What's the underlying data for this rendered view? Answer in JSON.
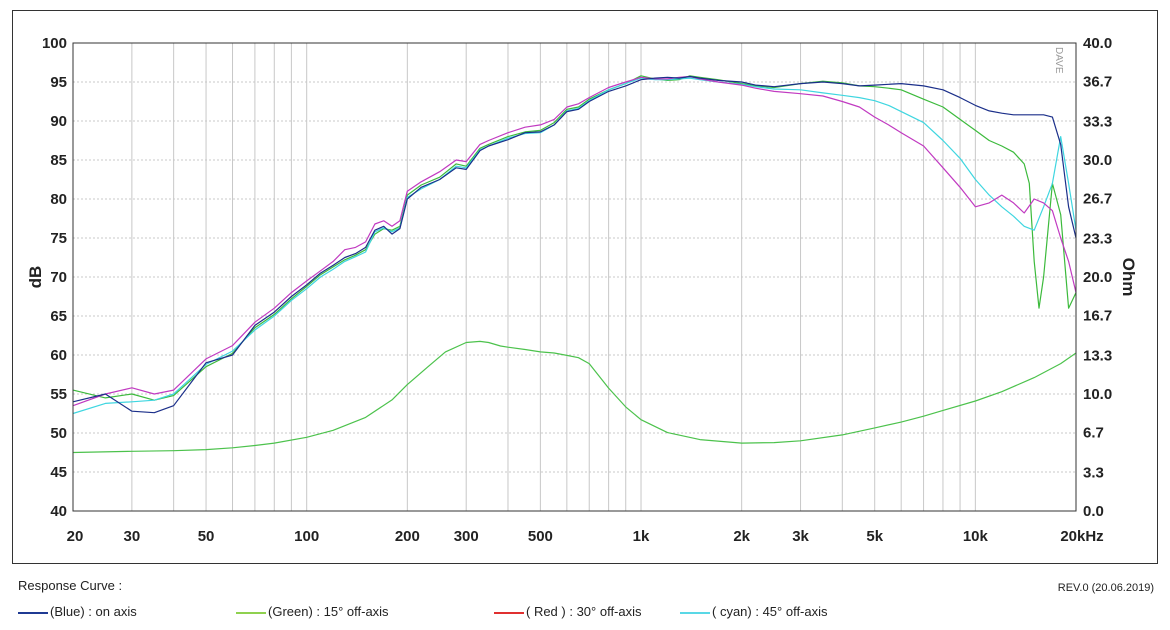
{
  "watermark": "DAVE",
  "footer": {
    "title": "Response Curve :",
    "revision": "REV.0 (20.06.2019)"
  },
  "chart_data": {
    "type": "line",
    "xlabel": "",
    "ylabel": "dB",
    "y2label": "Ohm",
    "xscale": "log",
    "xlim": [
      20,
      20000
    ],
    "ylim": [
      40,
      100
    ],
    "y2lim": [
      0,
      40
    ],
    "grid": true,
    "legend_position": "bottom",
    "x_ticks": [
      {
        "value": 20,
        "label": "20"
      },
      {
        "value": 30,
        "label": "30"
      },
      {
        "value": 50,
        "label": "50"
      },
      {
        "value": 100,
        "label": "100"
      },
      {
        "value": 200,
        "label": "200"
      },
      {
        "value": 300,
        "label": "300"
      },
      {
        "value": 500,
        "label": "500"
      },
      {
        "value": 1000,
        "label": "1k"
      },
      {
        "value": 2000,
        "label": "2k"
      },
      {
        "value": 3000,
        "label": "3k"
      },
      {
        "value": 5000,
        "label": "5k"
      },
      {
        "value": 10000,
        "label": "10k"
      },
      {
        "value": 20000,
        "label": "20kHz"
      }
    ],
    "y_ticks": [
      {
        "value": 40,
        "label": "40"
      },
      {
        "value": 45,
        "label": "45"
      },
      {
        "value": 50,
        "label": "50"
      },
      {
        "value": 55,
        "label": "55"
      },
      {
        "value": 60,
        "label": "60"
      },
      {
        "value": 65,
        "label": "65"
      },
      {
        "value": 70,
        "label": "70"
      },
      {
        "value": 75,
        "label": "75"
      },
      {
        "value": 80,
        "label": "80"
      },
      {
        "value": 85,
        "label": "85"
      },
      {
        "value": 90,
        "label": "90"
      },
      {
        "value": 95,
        "label": "95"
      },
      {
        "value": 100,
        "label": "100"
      }
    ],
    "y2_ticks": [
      {
        "value": 0,
        "label": "0.0"
      },
      {
        "value": 3.3,
        "label": "3.3"
      },
      {
        "value": 6.7,
        "label": "6.7"
      },
      {
        "value": 10,
        "label": "10.0"
      },
      {
        "value": 13.3,
        "label": "13.3"
      },
      {
        "value": 16.7,
        "label": "16.7"
      },
      {
        "value": 20,
        "label": "20.0"
      },
      {
        "value": 23.3,
        "label": "23.3"
      },
      {
        "value": 26.7,
        "label": "26.7"
      },
      {
        "value": 30,
        "label": "30.0"
      },
      {
        "value": 33.3,
        "label": "33.3"
      },
      {
        "value": 36.7,
        "label": "36.7"
      },
      {
        "value": 40,
        "label": "40.0"
      }
    ],
    "series": [
      {
        "name": "on axis",
        "legend": "(Blue)  : on axis",
        "color": "#1b2f8a",
        "swatch_color": "#1f3a93",
        "axis": "left",
        "x": [
          20,
          25,
          30,
          35,
          40,
          50,
          60,
          70,
          80,
          90,
          100,
          110,
          120,
          130,
          140,
          150,
          160,
          170,
          180,
          190,
          200,
          220,
          250,
          280,
          300,
          330,
          350,
          400,
          450,
          500,
          550,
          600,
          650,
          700,
          800,
          900,
          1000,
          1100,
          1200,
          1300,
          1400,
          1500,
          1700,
          2000,
          2200,
          2500,
          3000,
          3500,
          4000,
          4500,
          5000,
          5500,
          6000,
          7000,
          8000,
          9000,
          10000,
          11000,
          12000,
          13000,
          14000,
          15000,
          16000,
          17000,
          18000,
          19000,
          20000
        ],
        "y": [
          54,
          55,
          52.8,
          52.6,
          53.5,
          59,
          60,
          63.8,
          65.5,
          67.5,
          69,
          70.5,
          71.5,
          72.5,
          73,
          73.8,
          76,
          76.5,
          75.5,
          76.2,
          80,
          81.5,
          82.5,
          84,
          83.8,
          86.2,
          86.8,
          87.6,
          88.5,
          88.6,
          89.5,
          91.2,
          91.5,
          92.5,
          93.8,
          94.5,
          95.3,
          95.5,
          95.6,
          95.5,
          95.7,
          95.5,
          95.2,
          95,
          94.6,
          94.4,
          94.8,
          95,
          94.8,
          94.5,
          94.6,
          94.7,
          94.8,
          94.5,
          94,
          93,
          92,
          91.3,
          91,
          90.8,
          90.8,
          90.8,
          90.8,
          90.5,
          87,
          79,
          75
        ]
      },
      {
        "name": "15° off-axis",
        "legend": "(Green) : 15° off-axis",
        "color": "#3cba3c",
        "swatch_color": "#8fd14f",
        "axis": "left",
        "x": [
          20,
          25,
          30,
          35,
          40,
          50,
          60,
          70,
          80,
          90,
          100,
          110,
          120,
          130,
          140,
          150,
          160,
          170,
          180,
          190,
          200,
          220,
          250,
          280,
          300,
          330,
          350,
          400,
          450,
          500,
          550,
          600,
          650,
          700,
          800,
          900,
          1000,
          1100,
          1200,
          1300,
          1400,
          1500,
          1700,
          2000,
          2200,
          2500,
          3000,
          3500,
          4000,
          4500,
          5000,
          5500,
          6000,
          7000,
          8000,
          9000,
          10000,
          11000,
          12000,
          13000,
          14000,
          14500,
          15000,
          15500,
          16000,
          17000,
          18000,
          19000,
          20000
        ],
        "y": [
          55.5,
          54.5,
          55,
          54.2,
          54.8,
          58.5,
          60.2,
          63.5,
          65.2,
          67.2,
          68.8,
          70.3,
          71.3,
          72.2,
          72.8,
          73.5,
          75.5,
          76.2,
          76,
          76.5,
          80.5,
          81.8,
          82.8,
          84.5,
          84.2,
          86.5,
          87,
          88,
          88.6,
          88.8,
          89.8,
          91.5,
          91.8,
          92.8,
          94,
          94.8,
          95.8,
          95.4,
          95.2,
          95.3,
          95.8,
          95.6,
          95.3,
          94.8,
          94.5,
          94.3,
          94.8,
          95.1,
          94.9,
          94.5,
          94.4,
          94.2,
          94,
          92.8,
          91.8,
          90.2,
          88.8,
          87.5,
          86.8,
          86,
          84.5,
          82,
          72,
          66,
          70,
          82,
          78,
          66,
          68
        ]
      },
      {
        "name": "30° off-axis",
        "legend": "( Red ) : 30° off-axis",
        "color": "#c13ac1",
        "swatch_color": "#e03030",
        "axis": "left",
        "x": [
          20,
          25,
          30,
          35,
          40,
          50,
          60,
          70,
          80,
          90,
          100,
          110,
          120,
          130,
          140,
          150,
          160,
          170,
          180,
          190,
          200,
          220,
          250,
          280,
          300,
          330,
          350,
          400,
          450,
          500,
          550,
          600,
          650,
          700,
          800,
          900,
          1000,
          1100,
          1200,
          1300,
          1400,
          1500,
          1700,
          2000,
          2200,
          2500,
          3000,
          3500,
          4000,
          4500,
          5000,
          5500,
          6000,
          7000,
          8000,
          9000,
          10000,
          11000,
          12000,
          13000,
          14000,
          15000,
          16000,
          17000,
          18000,
          19000,
          20000
        ],
        "y": [
          53.5,
          55,
          55.8,
          55,
          55.5,
          59.5,
          61.2,
          64.2,
          66,
          68,
          69.5,
          70.8,
          72,
          73.5,
          73.8,
          74.5,
          76.8,
          77.2,
          76.5,
          77.2,
          81,
          82.2,
          83.5,
          85,
          84.8,
          87,
          87.5,
          88.5,
          89.2,
          89.5,
          90.2,
          91.8,
          92.2,
          93,
          94.3,
          95,
          95.6,
          95.4,
          95.4,
          95.6,
          95.7,
          95.4,
          95,
          94.6,
          94.2,
          93.8,
          93.5,
          93.2,
          92.5,
          91.8,
          90.5,
          89.5,
          88.5,
          86.8,
          84,
          81.5,
          79,
          79.5,
          80.5,
          79.5,
          78.2,
          80,
          79.5,
          78.5,
          75,
          72,
          68
        ]
      },
      {
        "name": "45° off-axis",
        "legend": "( cyan) : 45° off-axis",
        "color": "#3fd6e0",
        "swatch_color": "#59d8e6",
        "axis": "left",
        "x": [
          20,
          25,
          30,
          35,
          40,
          50,
          60,
          70,
          80,
          90,
          100,
          110,
          120,
          130,
          140,
          150,
          160,
          170,
          180,
          190,
          200,
          220,
          250,
          280,
          300,
          330,
          350,
          400,
          450,
          500,
          550,
          600,
          650,
          700,
          800,
          900,
          1000,
          1100,
          1200,
          1300,
          1400,
          1500,
          1700,
          2000,
          2200,
          2500,
          3000,
          3500,
          4000,
          4500,
          5000,
          5500,
          6000,
          7000,
          8000,
          9000,
          10000,
          11000,
          12000,
          13000,
          14000,
          15000,
          16000,
          17000,
          18000,
          19000,
          20000
        ],
        "y": [
          52.5,
          53.8,
          54,
          54.2,
          55,
          58.8,
          60.5,
          63.2,
          65,
          67,
          68.5,
          70,
          71,
          72,
          72.6,
          73.2,
          75.8,
          76.3,
          75.8,
          76.3,
          80.2,
          81.3,
          82.5,
          84.2,
          84,
          86.3,
          86.8,
          87.8,
          88.4,
          88.5,
          89.5,
          91.3,
          91.6,
          92.6,
          94,
          94.8,
          95.5,
          95.3,
          95.3,
          95.4,
          95.5,
          95.3,
          95,
          94.7,
          94.4,
          94.1,
          94,
          93.6,
          93.3,
          93,
          92.6,
          92,
          91.2,
          89.8,
          87.5,
          85.2,
          82.5,
          80.5,
          79,
          77.8,
          76.5,
          76,
          79,
          82,
          88,
          82,
          76
        ]
      },
      {
        "name": "impedance",
        "color": "#4cc24c",
        "axis": "right",
        "x": [
          20,
          30,
          40,
          50,
          60,
          70,
          80,
          100,
          120,
          150,
          180,
          200,
          230,
          260,
          300,
          330,
          350,
          380,
          400,
          450,
          500,
          550,
          600,
          650,
          700,
          800,
          900,
          1000,
          1200,
          1500,
          2000,
          2500,
          3000,
          4000,
          5000,
          6000,
          7000,
          8000,
          10000,
          12000,
          15000,
          18000,
          20000
        ],
        "y": [
          5,
          5.1,
          5.15,
          5.25,
          5.4,
          5.6,
          5.8,
          6.3,
          6.9,
          8,
          9.5,
          10.8,
          12.3,
          13.6,
          14.4,
          14.5,
          14.4,
          14.1,
          14,
          13.8,
          13.6,
          13.5,
          13.3,
          13.1,
          12.6,
          10.5,
          8.9,
          7.8,
          6.7,
          6.1,
          5.8,
          5.85,
          6,
          6.5,
          7.1,
          7.6,
          8.1,
          8.6,
          9.4,
          10.2,
          11.4,
          12.6,
          13.5
        ]
      }
    ]
  }
}
